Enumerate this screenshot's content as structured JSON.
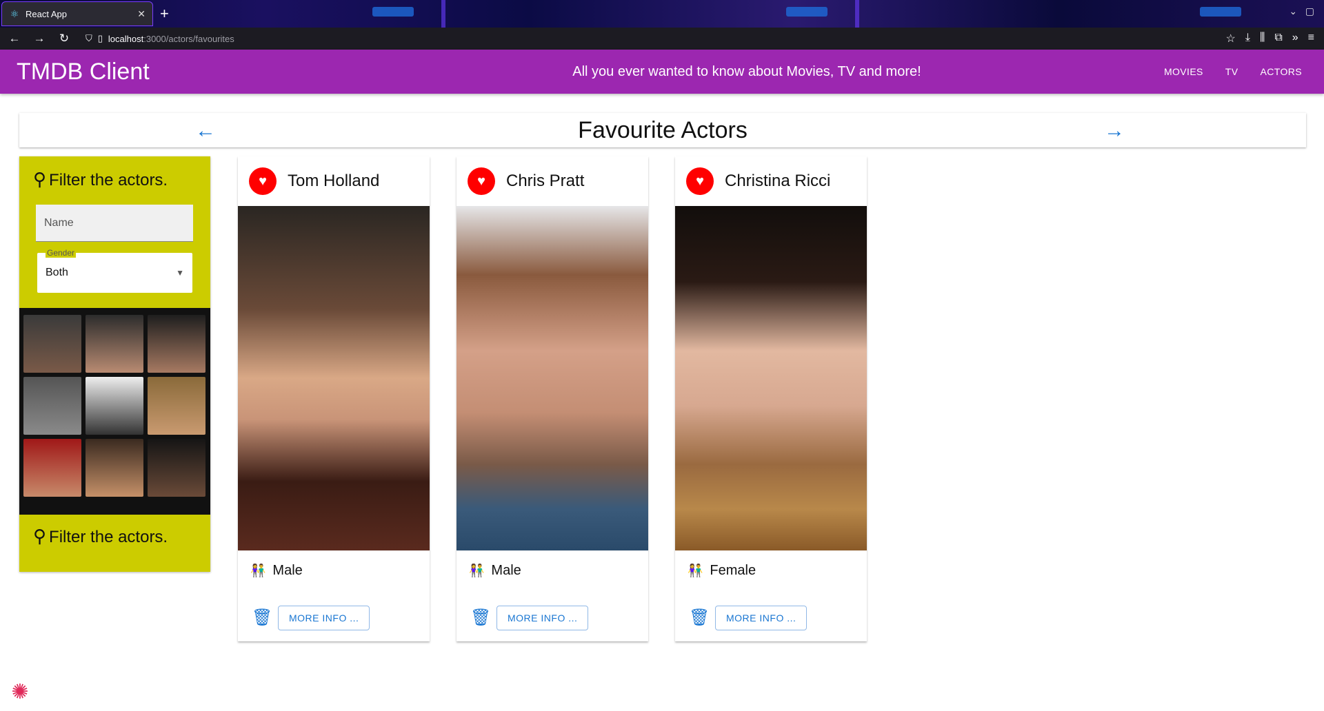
{
  "browser": {
    "tab_title": "React App",
    "url_host": "localhost",
    "url_path": ":3000/actors/favourites"
  },
  "appbar": {
    "brand": "TMDB Client",
    "tagline": "All you ever wanted to know about Movies, TV and more!",
    "menu": [
      "MOVIES",
      "TV",
      "ACTORS"
    ]
  },
  "page": {
    "title": "Favourite Actors"
  },
  "filter": {
    "title": "Filter the actors.",
    "name_placeholder": "Name",
    "gender_label": "Gender",
    "gender_value": "Both",
    "footer_title": "Filter the actors."
  },
  "actors": [
    {
      "name": "Tom Holland",
      "gender": "Male",
      "more_label": "MORE INFO ..."
    },
    {
      "name": "Chris Pratt",
      "gender": "Male",
      "more_label": "MORE INFO ..."
    },
    {
      "name": "Christina Ricci",
      "gender": "Female",
      "more_label": "MORE INFO ..."
    }
  ],
  "colors": {
    "appbar": "#9c27b0",
    "filter_panel": "#cccc00",
    "favourite_heart": "#ff0000",
    "action_blue": "#1976d2"
  },
  "icons": {
    "favourite": "heart-icon",
    "delete": "trash-icon",
    "gender": "people-icon",
    "search": "search-icon",
    "nav_back": "arrow-left-icon",
    "nav_forward": "arrow-right-icon"
  }
}
